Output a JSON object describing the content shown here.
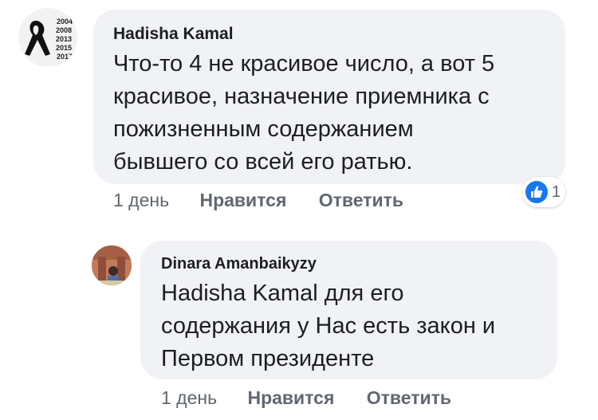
{
  "comments": [
    {
      "author": "Hadisha Kamal",
      "avatar_years": [
        "2004",
        "2008",
        "2013",
        "2015",
        "2017"
      ],
      "text": "Что-то 4 не красивое число, а вот 5\nкрасивое, назначение приемника с\nпожизненным содержанием\nбывшего со всей его ратью.",
      "time": "1 день",
      "like_label": "Нравится",
      "reply_label": "Ответить",
      "reaction_count": "1"
    },
    {
      "author": "Dinara Amanbaikyzy",
      "text": "Hadisha Kamal для его\nсодержания у Нас есть закон и\nПервом президенте",
      "time": "1 день",
      "like_label": "Нравится",
      "reply_label": "Ответить"
    }
  ],
  "colors": {
    "bubble": "#f1f2f6",
    "like_blue": "#1877f2",
    "meta_text": "#616770"
  }
}
